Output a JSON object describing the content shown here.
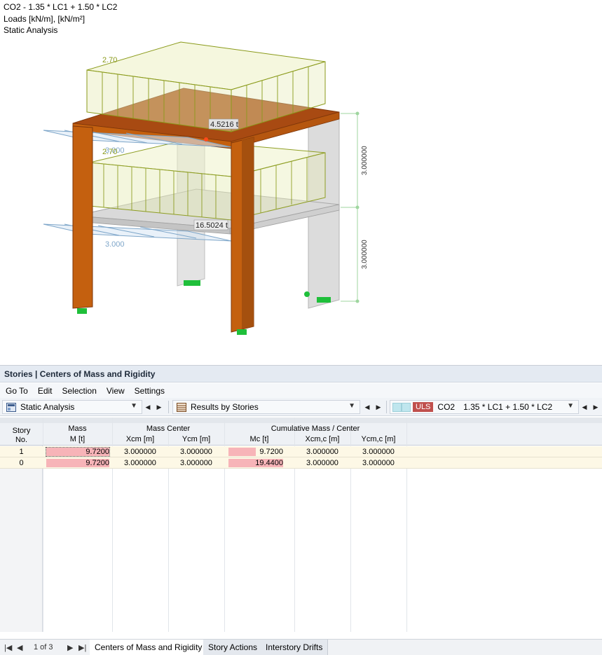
{
  "viewport": {
    "info_lines": [
      "CO2 - 1.35 * LC1 + 1.50 * LC2",
      "Loads [kN/m], [kN/m²]",
      "Static Analysis"
    ],
    "labels": {
      "load_top": "2.70",
      "load_mid": "2.70",
      "load_mid_overlap": "3.000",
      "load_bottom": "3.000",
      "mass_top": "4.5216 t",
      "mass_bottom": "16.5024 t",
      "dim_upper": "3.000000",
      "dim_lower": "3.000000"
    },
    "colors": {
      "column": "#c4600f",
      "slab": "#a84a12",
      "load": "#8a9a1a",
      "load_fill": "#e6ebb8",
      "support": "#1fbf3a",
      "concrete": "#d7d7d7",
      "dim": "#8fcf8f"
    }
  },
  "panel": {
    "title": "Stories | Centers of Mass and Rigidity",
    "menu": [
      "Go To",
      "Edit",
      "Selection",
      "View",
      "Settings"
    ],
    "analysis_combo": "Static Analysis",
    "results_combo": "Results by Stories",
    "combo_badge": "ULS",
    "combo_id": "CO2",
    "combo_formula": "1.35 * LC1 + 1.50 * LC2"
  },
  "table": {
    "group_headers": {
      "story": "Story",
      "mass": "Mass",
      "mass_center": "Mass Center",
      "cumulative": "Cumulative Mass / Center"
    },
    "sub_headers": {
      "story_no": "No.",
      "m": "M [t]",
      "xcm": "Xcm [m]",
      "ycm": "Ycm [m]",
      "mc": "Mc [t]",
      "xcmc": "Xcm,c [m]",
      "ycmc": "Ycm,c [m]"
    },
    "rows": [
      {
        "story": "1",
        "m": "9.7200",
        "xcm": "3.000000",
        "ycm": "3.000000",
        "mc": "9.7200",
        "xcmc": "3.000000",
        "ycmc": "3.000000",
        "m_frac": 1.0,
        "mc_frac": 0.5
      },
      {
        "story": "0",
        "m": "9.7200",
        "xcm": "3.000000",
        "ycm": "3.000000",
        "mc": "19.4400",
        "xcmc": "3.000000",
        "ycmc": "3.000000",
        "m_frac": 1.0,
        "mc_frac": 1.0
      }
    ]
  },
  "footer": {
    "page": "1 of 3",
    "tabs": [
      "Centers of Mass and Rigidity",
      "Story Actions",
      "Interstory Drifts"
    ]
  }
}
